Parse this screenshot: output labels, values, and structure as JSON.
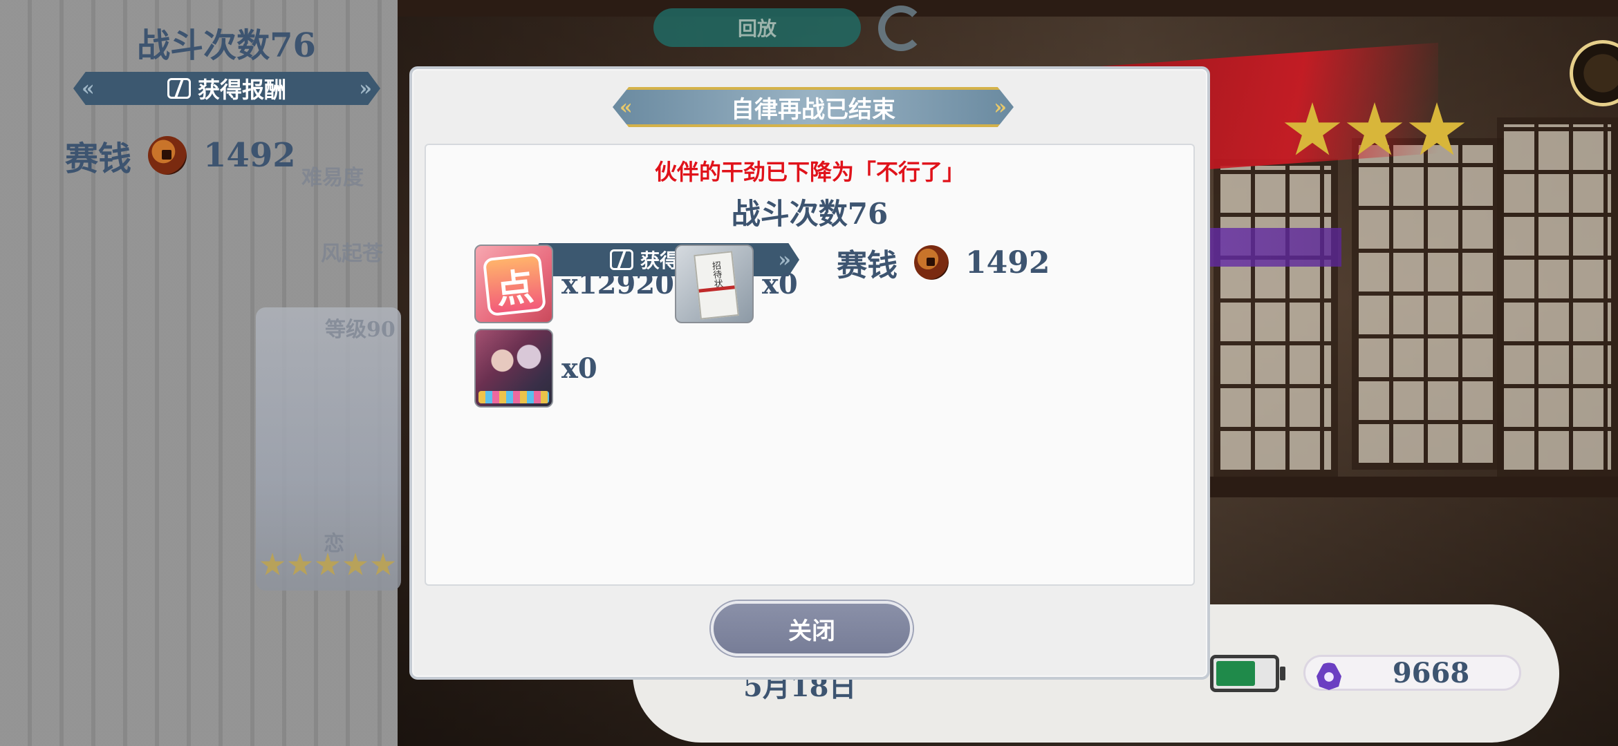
{
  "background": {
    "replay_label": "回放",
    "status": {
      "date": "5月18日",
      "currency_value": "9668"
    }
  },
  "left_panel": {
    "battle_count": "战斗次数76",
    "reward_label": "获得报酬",
    "coins_label": "赛钱",
    "coins_value": "1492",
    "difficulty_label": "难易度",
    "stage_label": "风起苍",
    "level_label": "等级90",
    "card_name": "恋"
  },
  "modal": {
    "title": "自律再战已结束",
    "warning": "伙伴的干劲已下降为「不行了」",
    "battle_count": "战斗次数76",
    "reward_label": "获得报酬",
    "coins_label": "赛钱",
    "coins_value": "1492",
    "items": [
      {
        "icon": "points-icon",
        "glyph": "点",
        "amount": "x12920"
      },
      {
        "icon": "invitation-icon",
        "glyph": "招待状",
        "amount": "x0"
      },
      {
        "icon": "character-card-icon",
        "amount": "x0"
      }
    ],
    "close_label": "关闭"
  },
  "colors": {
    "accent_text": "#3d5470",
    "warning": "#e0121a",
    "banner": "#3c5870",
    "button": "#7f859f"
  }
}
